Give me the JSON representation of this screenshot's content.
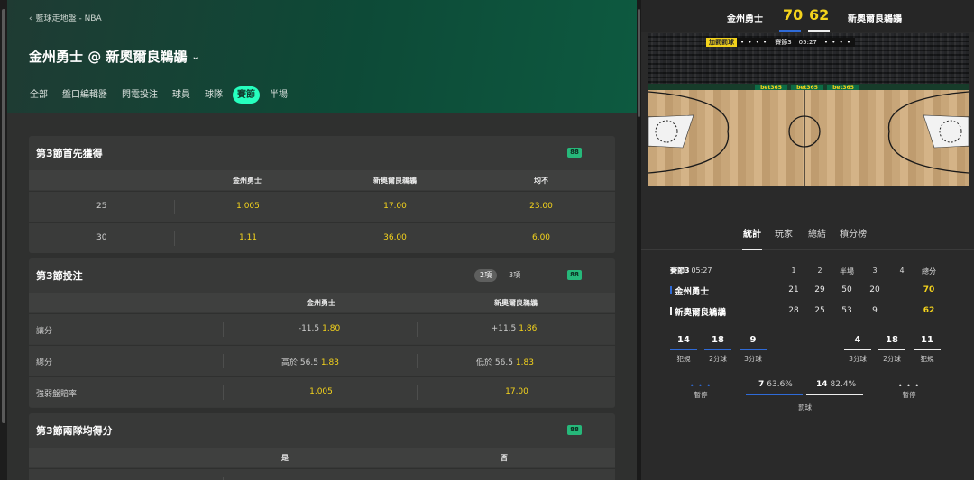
{
  "breadcrumb": "籃球走地盤 - NBA",
  "match_title": "金州勇士 @ 新奧爾良鵜鶘",
  "tabs": [
    {
      "label": "全部",
      "active": false
    },
    {
      "label": "盤口編輯器",
      "active": false
    },
    {
      "label": "閃電投注",
      "active": false
    },
    {
      "label": "球員",
      "active": false
    },
    {
      "label": "球隊",
      "active": false
    },
    {
      "label": "賽節",
      "active": true
    },
    {
      "label": "半場",
      "active": false
    }
  ],
  "badge": "88",
  "market1": {
    "title": "第3節首先獲得",
    "headers": [
      "金州勇士",
      "新奧爾良鵜鶘",
      "均不"
    ],
    "rows": [
      {
        "label": "25",
        "odds": [
          "1.005",
          "17.00",
          "23.00"
        ]
      },
      {
        "label": "30",
        "odds": [
          "1.11",
          "36.00",
          "6.00"
        ]
      }
    ]
  },
  "market2": {
    "title": "第3節投注",
    "pills": [
      "2項",
      "3項"
    ],
    "headers": [
      "金州勇士",
      "新奧爾良鵜鶘"
    ],
    "rows": [
      {
        "label": "讓分",
        "a_pre": "-11.5",
        "a": "1.80",
        "b_pre": "+11.5",
        "b": "1.86"
      },
      {
        "label": "總分",
        "a_pre": "高於 56.5",
        "a": "1.83",
        "b_pre": "低於 56.5",
        "b": "1.83"
      },
      {
        "label": "強弱盤賠率",
        "a_pre": "",
        "a": "1.005",
        "b_pre": "",
        "b": "17.00"
      }
    ]
  },
  "market3": {
    "title": "第3節兩隊均得分",
    "headers": [
      "是",
      "否"
    ]
  },
  "score": {
    "home": "金州勇士",
    "away": "新奧爾良鵜鶘",
    "home_score": "70",
    "away_score": "62"
  },
  "banner": {
    "bonus": "加罰罰球",
    "period": "賽節3",
    "clock": "05:27"
  },
  "court_ads": [
    "bet365",
    "bet365",
    "bet365"
  ],
  "stat_tabs": [
    {
      "label": "統計",
      "active": true
    },
    {
      "label": "玩家",
      "active": false
    },
    {
      "label": "總結",
      "active": false
    },
    {
      "label": "積分榜",
      "active": false
    }
  ],
  "scoreboard": {
    "period_label": "賽節3",
    "clock": "05:27",
    "columns": [
      "1",
      "2",
      "半場",
      "3",
      "4",
      "總分"
    ],
    "teams": [
      {
        "name": "金州勇士",
        "color": "#2f6bd8",
        "q": [
          "21",
          "29",
          "50",
          "20",
          ""
        ],
        "total": "70"
      },
      {
        "name": "新奧爾良鵜鶘",
        "color": "#eeeeee",
        "q": [
          "28",
          "25",
          "53",
          "9",
          ""
        ],
        "total": "62"
      }
    ]
  },
  "team_stats": {
    "home": [
      {
        "value": "14",
        "label": "犯規"
      },
      {
        "value": "18",
        "label": "2分球"
      },
      {
        "value": "9",
        "label": "3分球"
      }
    ],
    "away": [
      {
        "value": "4",
        "label": "3分球"
      },
      {
        "value": "18",
        "label": "2分球"
      },
      {
        "value": "11",
        "label": "犯規"
      }
    ]
  },
  "timeouts": {
    "label": "暫停",
    "home_dots": "• • •",
    "away_dots": "• • •"
  },
  "free_throws": {
    "label": "罰球",
    "home_value": "7",
    "home_pct": "63.6%",
    "away_value": "14",
    "away_pct": "82.4%"
  }
}
